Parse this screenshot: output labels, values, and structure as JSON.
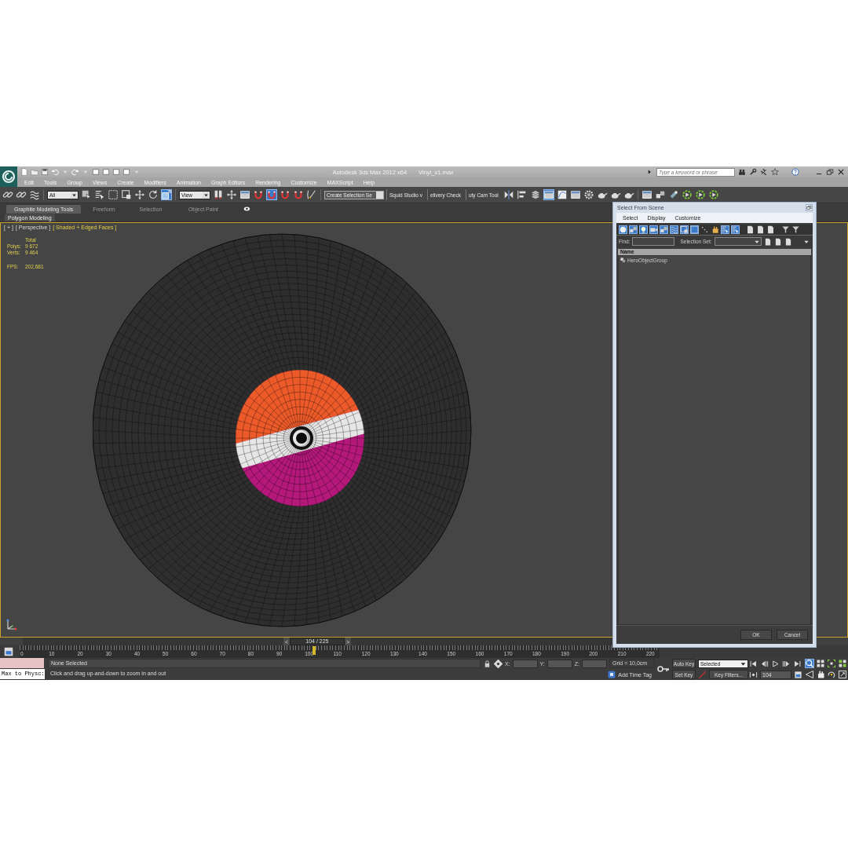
{
  "title_bar": {
    "app_title": "Autodesk 3ds Max  2012 x64",
    "file_name": "Vinyl_v1.max",
    "search": {
      "placeholder": "Type a keyword or phrase"
    }
  },
  "menu_bar": [
    "Edit",
    "Tools",
    "Group",
    "Views",
    "Create",
    "Modifiers",
    "Animation",
    "Graph Editors",
    "Rendering",
    "Customize",
    "MAXScript",
    "Help"
  ],
  "main_toolbar": [
    {
      "kind": "icon",
      "selected": false
    },
    {
      "kind": "icon",
      "selected": false
    },
    {
      "kind": "icon",
      "selected": false
    },
    {
      "kind": "dropdown",
      "value": "All"
    },
    {
      "kind": "icon",
      "selected": false
    },
    {
      "kind": "icon",
      "selected": false
    },
    {
      "kind": "icon",
      "selected": false
    },
    {
      "kind": "icon",
      "selected": false
    },
    {
      "kind": "icon",
      "selected": false
    },
    {
      "kind": "icon",
      "selected": false
    },
    {
      "kind": "icon",
      "selected": true
    },
    {
      "kind": "dropdown",
      "value": "View"
    },
    {
      "kind": "icon",
      "selected": false
    },
    {
      "kind": "icon",
      "selected": false
    },
    {
      "kind": "icon",
      "selected": false
    },
    {
      "kind": "icon",
      "selected": false
    },
    {
      "kind": "icon",
      "selected": true
    },
    {
      "kind": "icon",
      "selected": false
    },
    {
      "kind": "icon",
      "selected": false
    },
    {
      "kind": "icon",
      "selected": false
    },
    {
      "kind": "dropdown",
      "value": "Create Selection Se"
    },
    {
      "kind": "label",
      "text": "Squid Studio v"
    },
    {
      "kind": "label",
      "text": "elivery Check"
    },
    {
      "kind": "label",
      "text": "uty Cam Tool"
    },
    {
      "kind": "icon",
      "selected": false
    },
    {
      "kind": "icon",
      "selected": false
    },
    {
      "kind": "icon",
      "selected": false
    },
    {
      "kind": "icon",
      "selected": true
    },
    {
      "kind": "icon",
      "selected": false
    },
    {
      "kind": "icon",
      "selected": false
    },
    {
      "kind": "icon",
      "selected": false
    },
    {
      "kind": "icon",
      "selected": false
    },
    {
      "kind": "icon",
      "selected": false
    },
    {
      "kind": "icon",
      "selected": false
    },
    {
      "kind": "icon",
      "selected": false
    },
    {
      "kind": "icon",
      "selected": false
    },
    {
      "kind": "icon",
      "selected": false
    },
    {
      "kind": "icon",
      "selected": false
    },
    {
      "kind": "icon",
      "selected": false
    },
    {
      "kind": "icon",
      "selected": false
    }
  ],
  "ribbon": {
    "tabs": [
      {
        "label": "Graphite Modeling Tools",
        "selected": true
      },
      {
        "label": "Freeform",
        "selected": false
      },
      {
        "label": "Selection",
        "selected": false
      },
      {
        "label": "Object Paint",
        "selected": false
      }
    ],
    "panel": "Polygon Modeling"
  },
  "viewport": {
    "menu_label": "[ + ]",
    "view_label": "[ Perspective ]",
    "shading_label": "[ Shaded + Edged Faces ]",
    "stats": {
      "header": "Total",
      "rows": [
        {
          "label": "Polys:",
          "value": "9 672"
        },
        {
          "label": "Verts:",
          "value": "9 464"
        }
      ],
      "fps_label": "FPS:",
      "fps_value": "202,681"
    }
  },
  "dialog": {
    "title": "Select From Scene",
    "menu": [
      "Select",
      "Display",
      "Customize"
    ],
    "toolbar": [
      {
        "selected": true
      },
      {
        "selected": true
      },
      {
        "selected": true
      },
      {
        "selected": true
      },
      {
        "selected": true
      },
      {
        "selected": true
      },
      {
        "selected": true
      },
      {
        "selected": true
      },
      {
        "selected": false
      },
      {
        "selected": false
      },
      {
        "selected": true
      },
      {
        "selected": true
      },
      {
        "selected": false
      },
      {
        "selected": false
      },
      {
        "selected": false
      },
      {
        "selected": false
      },
      {
        "selected": false
      }
    ],
    "find_label": "Find:",
    "selection_set_label": "Selection Set:",
    "column": "Name",
    "rows": [
      {
        "name": "HeroObjectGroup",
        "selected": false
      }
    ],
    "buttons": [
      "OK",
      "Cancel"
    ]
  },
  "time_slider": {
    "prev": "<",
    "position": "104 / 225",
    "next": ">",
    "level": 0.46
  },
  "track_bar": {
    "ticks": [
      "0",
      "10",
      "20",
      "30",
      "40",
      "50",
      "60",
      "70",
      "80",
      "90",
      "100",
      "110",
      "120",
      "130",
      "140",
      "150",
      "160",
      "170",
      "180",
      "190",
      "200",
      "210",
      "220"
    ]
  },
  "status_bar": {
    "listener": "Max to Physc:",
    "selection": "None Selected",
    "prompt": "Click and drag up-and-down to zoom in and out",
    "x_label": "X:",
    "y_label": "Y:",
    "z_label": "Z:",
    "grid": "Grid = 10,0cm",
    "time_tag": "Add Time Tag",
    "auto_key": "Auto Key",
    "key_mode": "Selected",
    "set_key": "Set Key",
    "key_filters": "Key Filters...",
    "current_frame": "104"
  },
  "viewport_navigation": [
    {
      "selected": true
    },
    {
      "selected": false
    },
    {
      "selected": false
    },
    {
      "selected": false
    },
    {
      "selected": false
    },
    {
      "selected": false
    },
    {
      "selected": false
    },
    {
      "selected": false
    }
  ]
}
